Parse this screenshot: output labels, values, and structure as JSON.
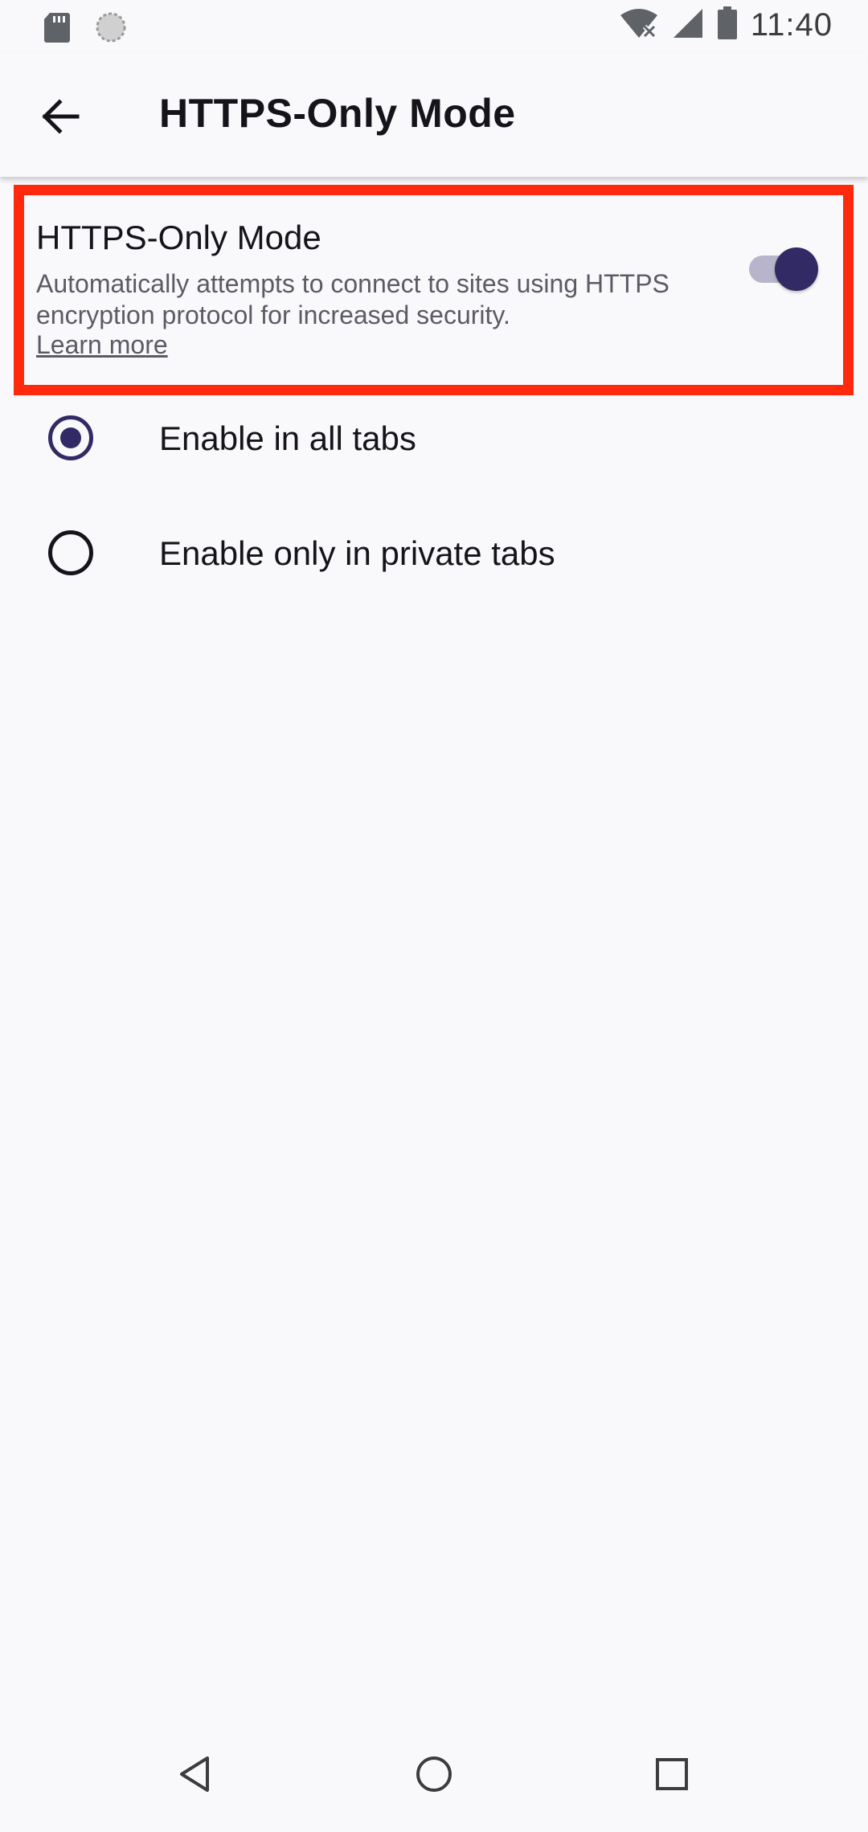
{
  "status_bar": {
    "time": "11:40",
    "icons": [
      "sd-card-icon",
      "sync-icon",
      "wifi-off-icon",
      "signal-icon",
      "battery-icon"
    ]
  },
  "app_bar": {
    "title": "HTTPS-Only Mode",
    "back_icon": "back-arrow-icon"
  },
  "https_only": {
    "title": "HTTPS-Only Mode",
    "summary": "Automatically attempts to connect to sites using HTTPS encryption protocol for increased security.",
    "learn_more": "Learn more",
    "enabled": true,
    "highlight_color": "#ff2a0e"
  },
  "options": [
    {
      "label": "Enable in all tabs",
      "selected": true
    },
    {
      "label": "Enable only in private tabs",
      "selected": false
    }
  ],
  "colors": {
    "accent": "#312a65",
    "track": "#b7b4cc",
    "background": "#f9f9fb"
  },
  "nav_bar": {
    "icons": [
      "nav-back-icon",
      "nav-home-icon",
      "nav-recents-icon"
    ]
  }
}
